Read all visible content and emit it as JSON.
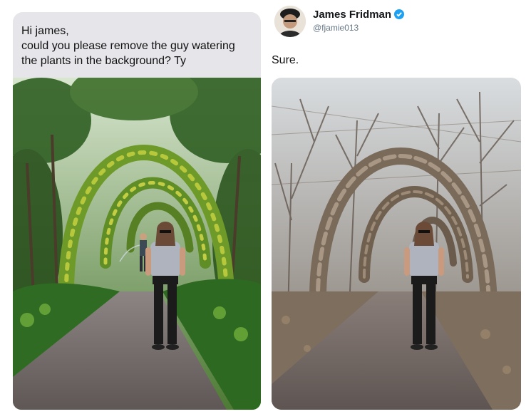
{
  "request": {
    "line1": "Hi james,",
    "line2": " could you please remove the guy watering",
    "line3": "the plants in the background? Ty"
  },
  "author": {
    "name": "James Fridman",
    "handle": "@fjamie013",
    "verified_color": "#1da1f2"
  },
  "reply": {
    "text": "Sure."
  },
  "colors": {
    "bubble": "#e5e5ea",
    "foliage": "#3f7a2b",
    "bare_branches": "#8a7a66",
    "path": "#6f6763"
  }
}
